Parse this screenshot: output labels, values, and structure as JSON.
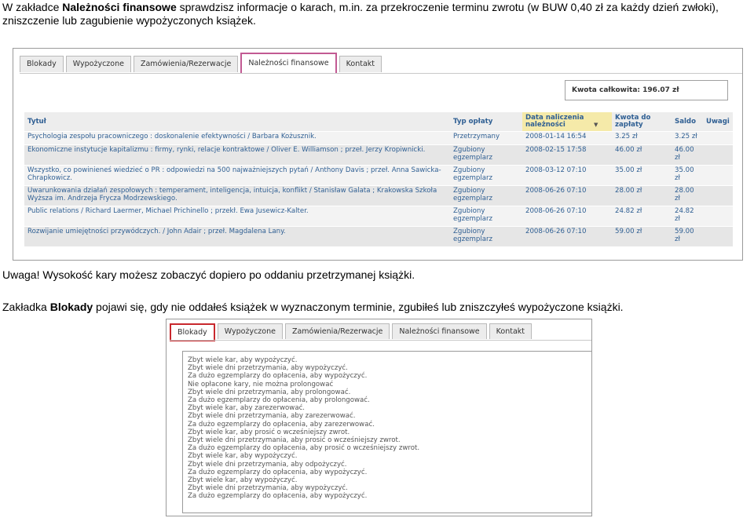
{
  "intro": {
    "pre": "W zakładce ",
    "bold": "Należności finansowe",
    "post": " sprawdzisz informacje o karach, m.in. za przekroczenie terminu zwrotu (w BUW 0,40 zł za każdy dzień zwłoki),",
    "line2": "zniszczenie lub zagubienie wypożyczonych książek."
  },
  "screenshot1": {
    "tabs": [
      "Blokady",
      "Wypożyczone",
      "Zamówienia/Rezerwacje",
      "Należności finansowe",
      "Kontakt"
    ],
    "active_tab": "Należności finansowe",
    "total": "Kwota całkowita: 196.07 zł",
    "columns": [
      "Tytuł",
      "Typ opłaty",
      "Data naliczenia należności",
      "Kwota do zapłaty",
      "Saldo",
      "Uwagi"
    ],
    "rows": [
      {
        "title": "Psychologia zespołu pracowniczego : doskonalenie efektywności / Barbara Kożusznik.",
        "type": "Przetrzymany",
        "date": "2008-01-14 16:54",
        "amount": "3.25 zł",
        "balance": "3.25 zł",
        "notes": ""
      },
      {
        "title": "Ekonomiczne instytucje kapitalizmu : firmy, rynki, relacje kontraktowe / Oliver E. Williamson ; przeł. Jerzy Kropiwnicki.",
        "type": "Zgubiony egzemplarz",
        "date": "2008-02-15 17:58",
        "amount": "46.00 zł",
        "balance": "46.00 zł",
        "notes": ""
      },
      {
        "title": "Wszystko, co powinieneś wiedzieć o PR : odpowiedzi na 500 najważniejszych pytań / Anthony Davis ; przeł. Anna Sawicka-Chrapkowicz.",
        "type": "Zgubiony egzemplarz",
        "date": "2008-03-12 07:10",
        "amount": "35.00 zł",
        "balance": "35.00 zł",
        "notes": ""
      },
      {
        "title": "Uwarunkowania działań zespołowych : temperament, inteligencja, intuicja, konflikt / Stanisław Galata ; Krakowska Szkoła Wyższa im. Andrzeja Frycza Modrzewskiego.",
        "type": "Zgubiony egzemplarz",
        "date": "2008-06-26 07:10",
        "amount": "28.00 zł",
        "balance": "28.00 zł",
        "notes": ""
      },
      {
        "title": "Public relations / Richard Laermer, Michael Prichinello ; przekł. Ewa Jusewicz-Kalter.",
        "type": "Zgubiony egzemplarz",
        "date": "2008-06-26 07:10",
        "amount": "24.82 zł",
        "balance": "24.82 zł",
        "notes": ""
      },
      {
        "title": "Rozwijanie umiejętności przywódczych. / John Adair ; przeł. Magdalena Lany.",
        "type": "Zgubiony egzemplarz",
        "date": "2008-06-26 07:10",
        "amount": "59.00 zł",
        "balance": "59.00 zł",
        "notes": ""
      }
    ]
  },
  "warning": "Uwaga! Wysokość kary możesz zobaczyć dopiero po oddaniu przetrzymanej książki.",
  "blokady_para": {
    "pre": "Zakładka ",
    "bold": "Blokady",
    "post": " pojawi się, gdy nie oddałeś książek w wyznaczonym terminie, zgubiłeś lub zniszczyłeś wypożyczone książki."
  },
  "screenshot2": {
    "tabs": [
      "Blokady",
      "Wypożyczone",
      "Zamówienia/Rezerwacje",
      "Należności finansowe",
      "Kontakt"
    ],
    "active_tab": "Blokady",
    "blocks": [
      "Zbyt wiele kar, aby wypożyczyć.",
      "Zbyt wiele dni przetrzymania, aby wypożyczyć.",
      "Za dużo egzemplarzy do opłacenia, aby wypożyczyć.",
      "Nie opłacone kary, nie można prolongować",
      "Zbyt wiele dni przetrzymania, aby prolongować.",
      "Za dużo egzemplarzy do opłacenia, aby prolongować.",
      "Zbyt wiele kar, aby zarezerwować.",
      "Zbyt wiele dni przetrzymania, aby zarezerwować.",
      "Za dużo egzemplarzy do opłacenia, aby zarezerwować.",
      "Zbyt wiele kar, aby prosić o wcześniejszy zwrot.",
      "Zbyt wiele dni przetrzymania, aby prosić o wcześniejszy zwrot.",
      "Za dużo egzemplarzy do opłacenia, aby prosić o wcześniejszy zwrot.",
      "Zbyt wiele kar, aby wypożyczyć.",
      "Zbyt wiele dni przetrzymania, aby odpożyczyć.",
      "Za dużo egzemplarzy do opłacenia, aby wypożyczyć.",
      "Zbyt wiele kar, aby wypożyczyć.",
      "Zbyt wiele dni przetrzymania, aby wypożyczyć.",
      "Za dużo egzemplarzy do opłacenia, aby wypożyczyć."
    ]
  }
}
